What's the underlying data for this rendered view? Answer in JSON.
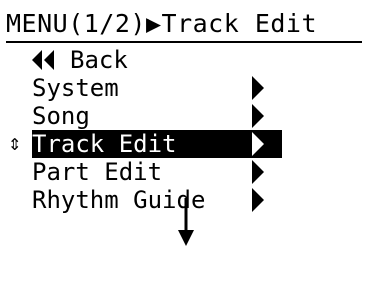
{
  "screen": {
    "title": "MENU(1/2)▶Track Edit",
    "menu": {
      "back_label": "Back",
      "items": [
        {
          "label": "System",
          "selected": false
        },
        {
          "label": "Song",
          "selected": false
        },
        {
          "label": "Track Edit",
          "selected": true
        },
        {
          "label": "Part Edit",
          "selected": false
        },
        {
          "label": "Rhythm Guide",
          "selected": false
        }
      ],
      "cursor_symbol": "⇕"
    }
  }
}
